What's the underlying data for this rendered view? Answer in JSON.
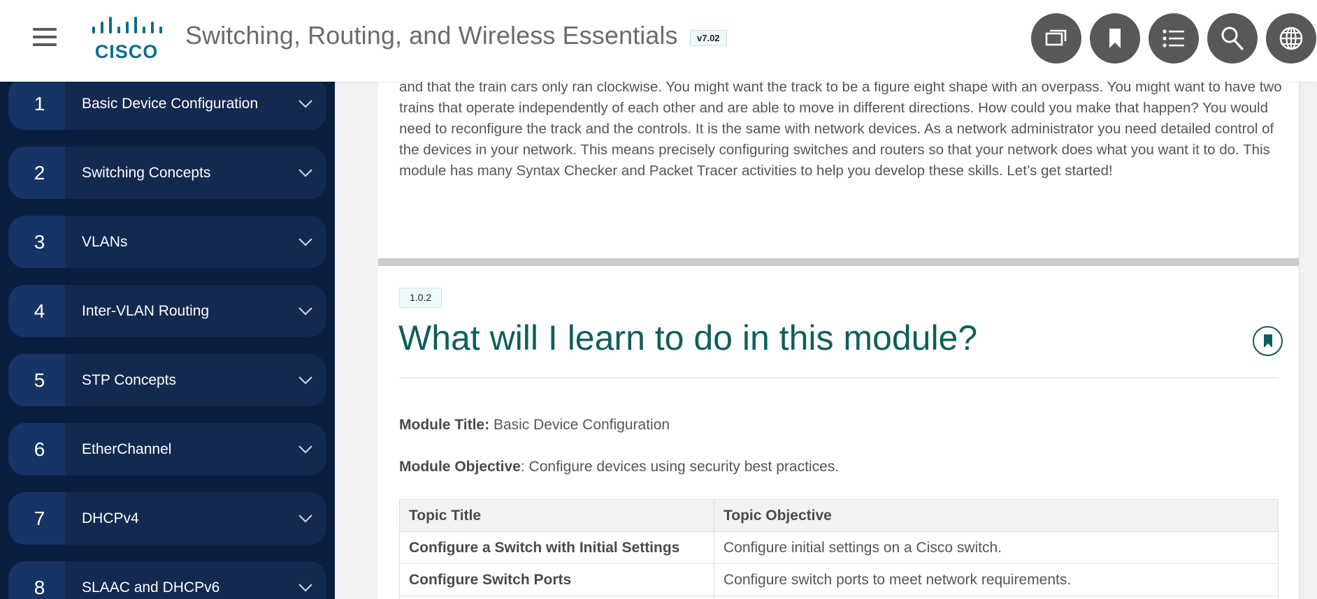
{
  "header": {
    "title": "Switching, Routing, and Wireless Essentials",
    "version": "v7.02",
    "logo_text": "CISCO",
    "buttons": [
      {
        "name": "windows-button",
        "icon": "windows-icon"
      },
      {
        "name": "bookmarks-button",
        "icon": "bookmark-icon"
      },
      {
        "name": "index-button",
        "icon": "list-icon"
      },
      {
        "name": "search-button",
        "icon": "search-icon"
      },
      {
        "name": "language-button",
        "icon": "globe-icon"
      }
    ]
  },
  "sidebar": {
    "modules": [
      {
        "number": "1",
        "label": "Basic Device Configuration"
      },
      {
        "number": "2",
        "label": "Switching Concepts"
      },
      {
        "number": "3",
        "label": "VLANs"
      },
      {
        "number": "4",
        "label": "Inter-VLAN Routing"
      },
      {
        "number": "5",
        "label": "STP Concepts"
      },
      {
        "number": "6",
        "label": "EtherChannel"
      },
      {
        "number": "7",
        "label": "DHCPv4"
      },
      {
        "number": "8",
        "label": "SLAAC and DHCPv6"
      }
    ]
  },
  "content": {
    "intro_text": "and that the train cars only ran clockwise. You might want the track to be a figure eight shape with an overpass. You might want to have two trains that operate independently of each other and are able to move in different directions. How could you make that happen? You would need to reconfigure the track and the controls. It is the same with network devices. As a network administrator you need detailed control of the devices in your network. This means precisely configuring switches and routers so that your network does what you want it to do. This module has many Syntax Checker and Packet Tracer activities to help you develop these skills. Let’s get started!",
    "section": {
      "number": "1.0.2",
      "title": "What will I learn to do in this module?",
      "module_title_label": "Module Title:",
      "module_title_value": " Basic Device Configuration",
      "module_objective_label": "Module Objective",
      "module_objective_value": ": Configure devices using security best practices.",
      "table": {
        "headers": [
          "Topic Title",
          "Topic Objective"
        ],
        "rows": [
          [
            "Configure a Switch with Initial Settings",
            "Configure initial settings on a Cisco switch."
          ],
          [
            "Configure Switch Ports",
            "Configure switch ports to meet network requirements."
          ]
        ]
      }
    }
  },
  "colors": {
    "accent_teal": "#0d5f5a",
    "sidebar_bg": "#0b1e3f",
    "module_bg": "#13294f",
    "header_button": "#58585a",
    "cisco_logo": "#0e6d8a"
  }
}
